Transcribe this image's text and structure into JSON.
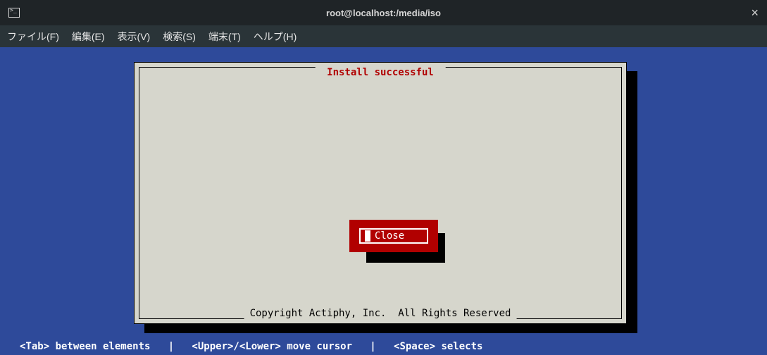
{
  "window": {
    "title": "root@localhost:/media/iso"
  },
  "menubar": {
    "file": "ファイル(F)",
    "edit": "編集(E)",
    "view": "表示(V)",
    "search": "検索(S)",
    "terminal": "端末(T)",
    "help": "ヘルプ(H)"
  },
  "dialog": {
    "title": " Install successful ",
    "copyright": "Copyright Actiphy, Inc.  All Rights Reserved",
    "close_label": "Close"
  },
  "footer": {
    "hints": "<Tab> between elements   |   <Upper>/<Lower> move cursor   |   <Space> selects"
  }
}
